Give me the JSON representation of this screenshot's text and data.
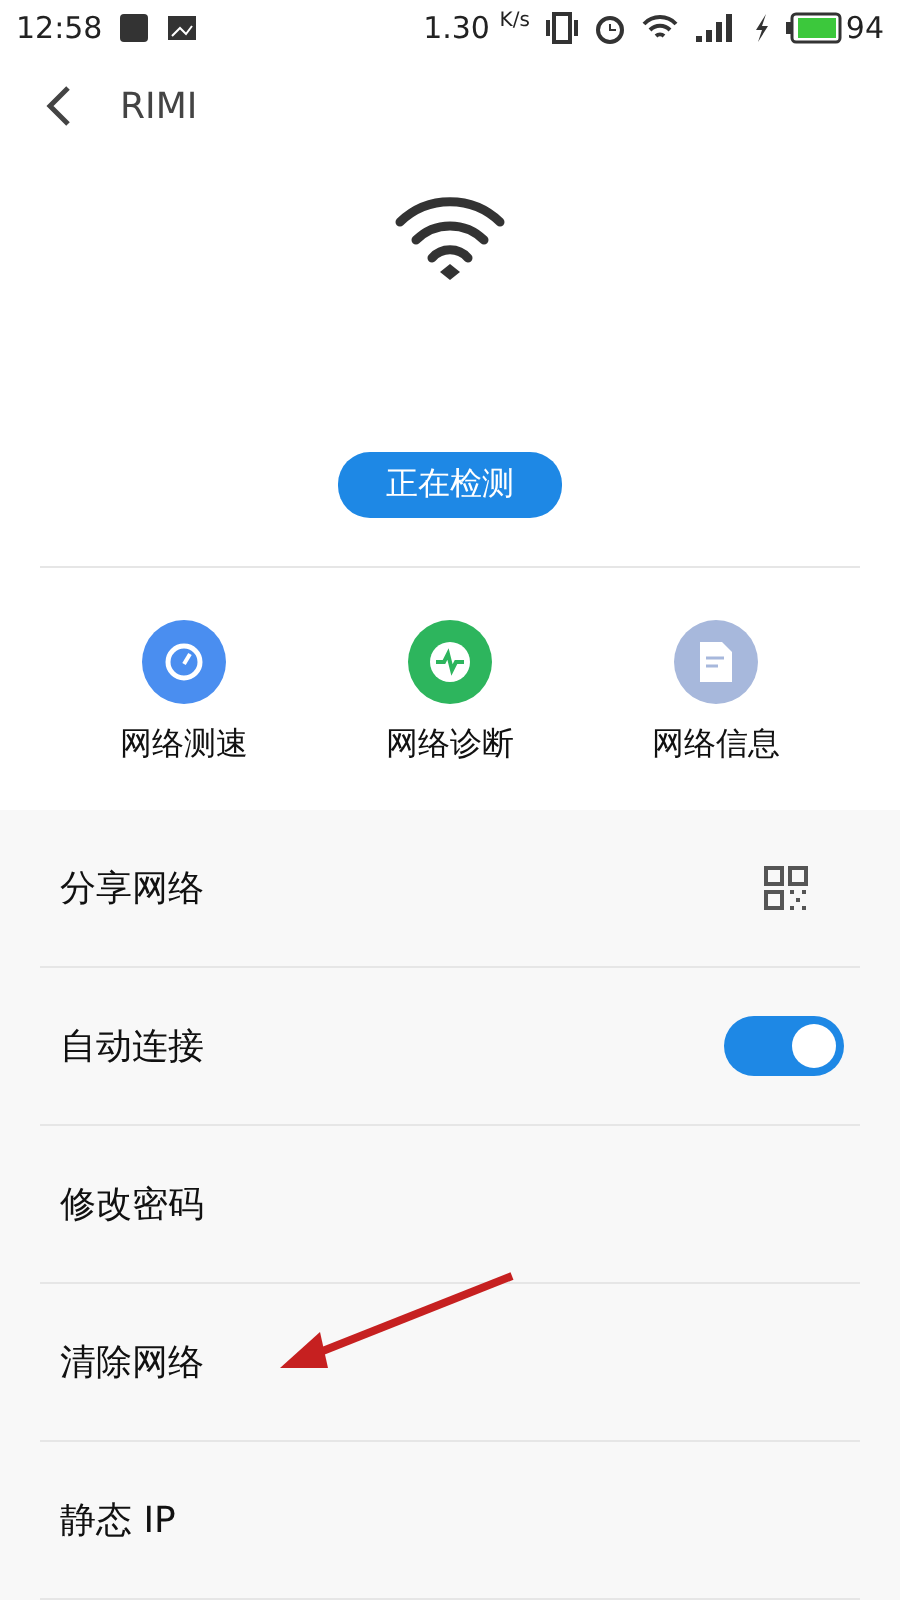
{
  "status_bar": {
    "time": "12:58",
    "speed": "1.30",
    "speed_unit": "K/s",
    "battery": "94"
  },
  "header": {
    "title": "RIMI"
  },
  "detect_button": {
    "label": "正在检测"
  },
  "actions": [
    {
      "label": "网络测速",
      "kind": "speed",
      "color": "#4a8ef0"
    },
    {
      "label": "网络诊断",
      "kind": "diagnose",
      "color": "#2db55d"
    },
    {
      "label": "网络信息",
      "kind": "info",
      "color": "#a7b8dc"
    }
  ],
  "settings": [
    {
      "label": "分享网络",
      "kind": "qr"
    },
    {
      "label": "自动连接",
      "kind": "switch",
      "on": true
    },
    {
      "label": "修改密码",
      "kind": "plain"
    },
    {
      "label": "清除网络",
      "kind": "plain"
    },
    {
      "label": "静态 IP",
      "kind": "plain"
    }
  ]
}
